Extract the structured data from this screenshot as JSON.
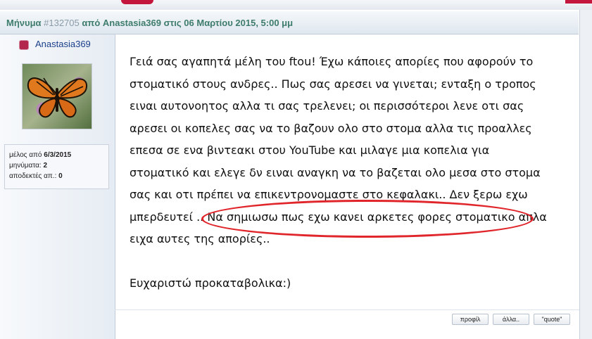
{
  "header": {
    "label": "Μήνυμα",
    "post_id": "#132705",
    "rest": "από Anastasia369 στις 06 Μαρτίου 2015, 5:00 μμ"
  },
  "user": {
    "name": "Anastasia369",
    "avatar_icon": "butterfly-avatar-image"
  },
  "stats": {
    "member_since_label": "μέλος από",
    "member_since": "6/3/2015",
    "posts_label": "μηνύματα:",
    "posts": "2",
    "accepted_label": "αποδεκτές απ.:",
    "accepted": "0"
  },
  "post": {
    "lines": [
      "Γειά σας αγαπητά μέλη του ftou! Έχω κάποιες απορίες που αφορούν το",
      "στοματικό στους ανδρες.. Πως σας αρεσει να γινεται; ενταξη ο τροπος",
      "ειναι αυτονοητος αλλα τι σας τρελενει; οι περισσότεροι λενε οτι σας",
      "αρεσει οι κοπελες σας να το βαζουν ολο στο στομα αλλα τις προαλλες",
      "επεσα σε ενα βιντεακι στου YouTube και μιλαγε μια κοπελια για",
      "στοματικό και ελεγε δν ειναι αναγκη να το βαζεται ολο μεσα στο στομα",
      "σας και οτι πρέπει να επικεντρονομαστε στο κεφαλακι.. Δεν ξερω εχω",
      "μπερδευτεί .. Να σημιωσω πως εχω κανει αρκετες φορες στοματικο απλα",
      "ειχα αυτες της απορίες.."
    ],
    "closing": "Ευχαριστώ προκαταβολικα:)"
  },
  "footer": {
    "profile_label": "προφίλ",
    "more_label": "άλλα..",
    "quote_label": "\"quote\""
  },
  "colors": {
    "header_text": "#3e7c6d",
    "username": "#1a3f8a",
    "annotation_circle": "#e0252b",
    "accent": "#c4163d"
  }
}
